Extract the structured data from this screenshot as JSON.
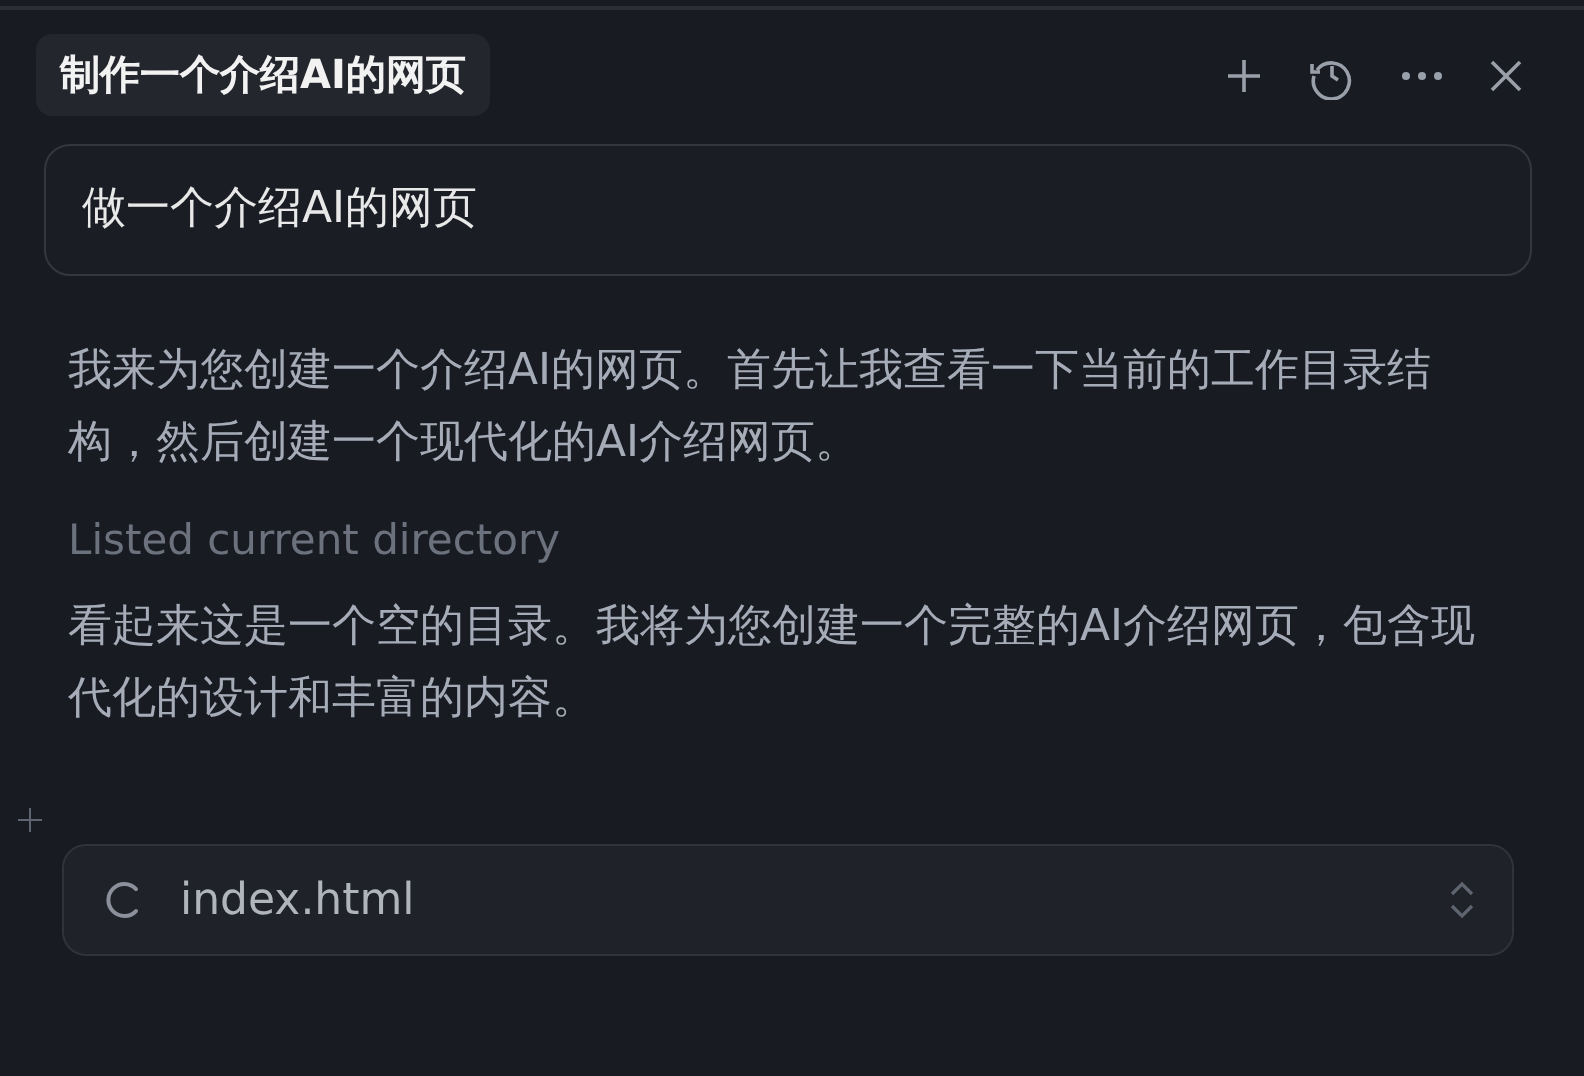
{
  "header": {
    "title": "制作一个介绍AI的网页"
  },
  "prompt": {
    "value": "做一个介绍AI的网页"
  },
  "messages": [
    {
      "kind": "text",
      "text": "我来为您创建一个介绍AI的网页。首先让我查看一下当前的工作目录结构，然后创建一个现代化的AI介绍网页。"
    },
    {
      "kind": "action",
      "text": "Listed current directory"
    },
    {
      "kind": "text",
      "text": "看起来这是一个空的目录。我将为您创建一个完整的AI介绍网页，包含现代化的设计和丰富的内容。"
    }
  ],
  "file": {
    "name": "index.html"
  }
}
